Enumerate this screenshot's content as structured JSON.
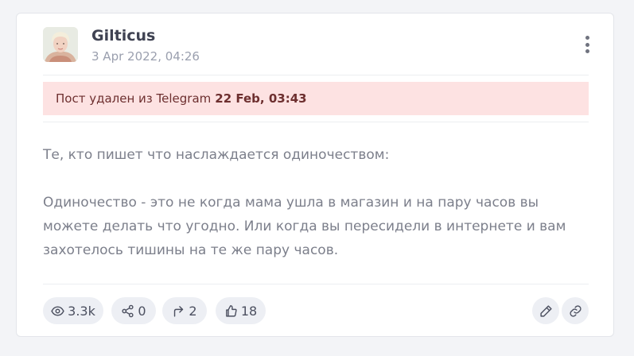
{
  "post": {
    "author": "Gilticus",
    "date": "3 Apr 2022, 04:26",
    "notice": {
      "text": "Пост удален из Telegram",
      "date": "22 Feb, 03:43"
    },
    "paragraphs": [
      "Те, кто пишет что наслаждается одиночеством:",
      "Одиночество - это не когда мама ушла в магазин и на пару часов вы можете делать что угодно. Или когда вы пересидели в интернете и вам захотелось тишины на те же пару часов."
    ]
  },
  "stats": {
    "views": "3.3k",
    "shares": "0",
    "forwards": "2",
    "likes": "18"
  },
  "icons": {
    "views": "eye-icon",
    "shares": "share-icon",
    "forwards": "forward-arrow-icon",
    "likes": "thumbs-up-icon",
    "edit": "pencil-icon",
    "link": "link-icon",
    "menu": "more-vertical-icon"
  },
  "colors": {
    "notice_bg": "#fde2e2",
    "notice_text": "#6d2f2f",
    "pill_bg": "#edeff4"
  }
}
